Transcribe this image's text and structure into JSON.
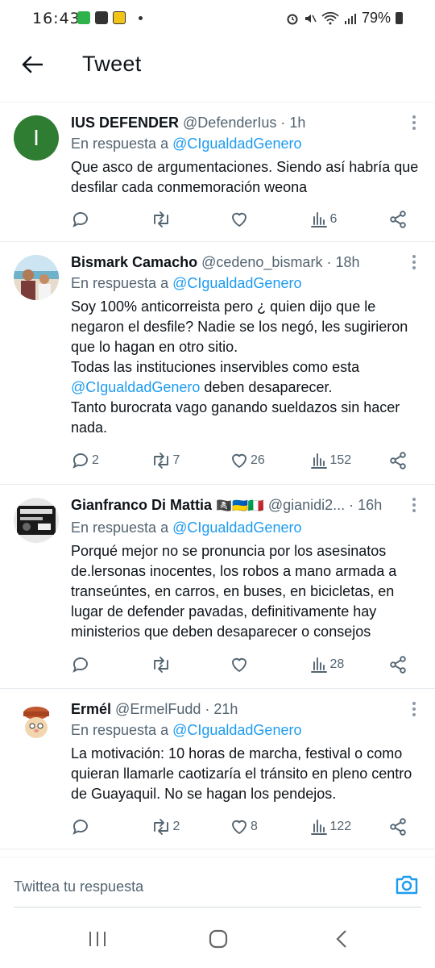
{
  "status_bar": {
    "time": "16:43",
    "battery": "79%"
  },
  "header": {
    "title": "Tweet"
  },
  "tweets": [
    {
      "avatar_letter": "I",
      "name": "IUS DEFENDER",
      "handle": "@DefenderIus",
      "time": "· 1h",
      "reply_prefix": "En respuesta a ",
      "reply_to": "@CIgualdadGenero",
      "text": "Que asco de argumentaciones. Siendo así habría que desfilar cada conmemoración weona",
      "stats": {
        "replies": "",
        "retweets": "",
        "likes": "",
        "views": "6"
      }
    },
    {
      "name": "Bismark Camacho",
      "handle": "@cedeno_bismark",
      "time": "· 18h",
      "reply_prefix": "En respuesta a ",
      "reply_to": "@CIgualdadGenero",
      "text_part1": "Soy 100% anticorreista pero ¿ quien dijo que le negaron el desfile? Nadie se los negó, les sugirieron que lo hagan en otro sitio.",
      "text_part2": "Todas las instituciones inservibles como esta",
      "text_mention": "@CIgualdadGenero",
      "text_part3": " deben desaparecer.",
      "text_part4": "Tanto burocrata vago ganando sueldazos sin hacer nada.",
      "stats": {
        "replies": "2",
        "retweets": "7",
        "likes": "26",
        "views": "152"
      }
    },
    {
      "name": "Gianfranco Di Mattia",
      "flags": "🏴‍☠️🇺🇦🇮🇹",
      "handle": "@gianidi2...",
      "time": "· 16h",
      "reply_prefix": "En respuesta a ",
      "reply_to": "@CIgualdadGenero",
      "text": "Porqué mejor no se pronuncia por los asesinatos de.lersonas inocentes, los robos a mano armada a transeúntes, en carros, en buses, en bicicletas, en lugar de defender pavadas, definitivamente hay ministerios que deben desaparecer o consejos",
      "stats": {
        "replies": "",
        "retweets": "",
        "likes": "",
        "views": "28"
      }
    },
    {
      "name": "Ermél",
      "handle": "@ErmelFudd",
      "time": "· 21h",
      "reply_prefix": "En respuesta a ",
      "reply_to": "@CIgualdadGenero",
      "text": "La motivación: 10 horas de marcha, festival o como quieran llamarle caotizaría el tránsito en pleno centro de Guayaquil. No se hagan los pendejos.",
      "stats": {
        "replies": "",
        "retweets": "2",
        "likes": "8",
        "views": "122"
      }
    }
  ],
  "reply_bar": {
    "placeholder": "Twittea tu respuesta"
  }
}
